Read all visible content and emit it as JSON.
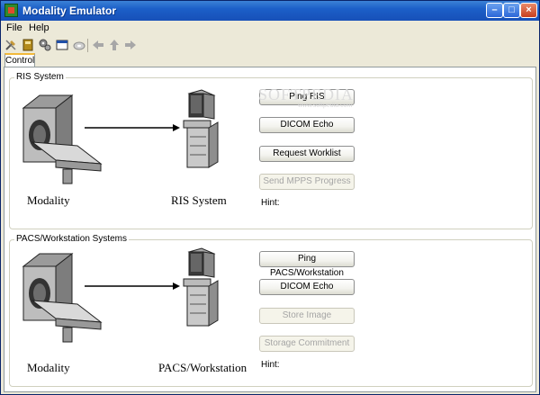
{
  "window": {
    "title": "Modality Emulator"
  },
  "menu": [
    "File",
    "Help"
  ],
  "tabs": [
    {
      "label": "Control"
    }
  ],
  "ris": {
    "group_label": "RIS System",
    "modality_caption": "Modality",
    "target_caption": "RIS System",
    "buttons": [
      {
        "label": "Ping RIS",
        "enabled": true
      },
      {
        "label": "DICOM Echo",
        "enabled": true
      },
      {
        "label": "Request Worklist",
        "enabled": true
      },
      {
        "label": "Send MPPS Progress",
        "enabled": false
      }
    ],
    "hint_label": "Hint:"
  },
  "pacs": {
    "group_label": "PACS/Workstation Systems",
    "modality_caption": "Modality",
    "target_caption": "PACS/Workstation",
    "buttons": [
      {
        "label": "Ping PACS/Workstation",
        "enabled": true
      },
      {
        "label": "DICOM Echo",
        "enabled": true
      },
      {
        "label": "Store Image",
        "enabled": false
      },
      {
        "label": "Storage Commitment",
        "enabled": false
      }
    ],
    "hint_label": "Hint:"
  },
  "watermark": {
    "text": "SOFTPEDIA",
    "subtext": "www.softpedia.com"
  },
  "toolbar": [
    "tools-icon",
    "book-icon",
    "gears-icon",
    "window-icon",
    "disc-icon",
    "back-arrow-icon",
    "up-arrow-icon",
    "forward-arrow-icon"
  ],
  "colors": {
    "title_bar": "#1c5fc8",
    "window_bg": "#ece9d8",
    "panel_bg": "#ffffff"
  }
}
